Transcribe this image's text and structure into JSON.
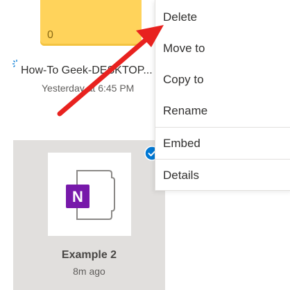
{
  "folder": {
    "count": "0",
    "name": "How-To Geek-DESKTOP...",
    "modified": "Yesterday at 6:45 PM",
    "color": "#ffd35b"
  },
  "file": {
    "name": "Example 2",
    "modified": "8m ago",
    "icon": "onenote-icon",
    "accent": "#7719aa",
    "selected": true
  },
  "context_menu": {
    "items": [
      {
        "label": "Delete"
      },
      {
        "label": "Move to"
      },
      {
        "label": "Copy to"
      },
      {
        "label": "Rename"
      },
      {
        "label": "Embed"
      },
      {
        "label": "Details"
      }
    ]
  },
  "annotation": {
    "type": "arrow",
    "color": "#e8221f",
    "points_to": "Delete"
  }
}
